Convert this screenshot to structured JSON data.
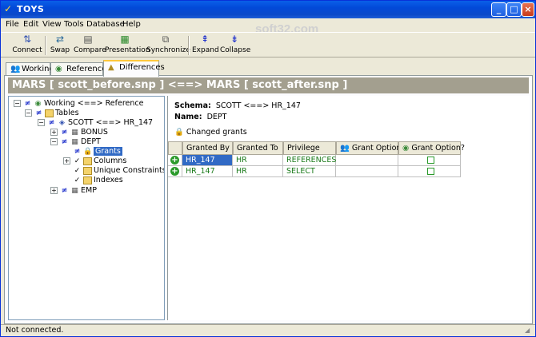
{
  "window": {
    "title": "TOYS",
    "app_icon": "check-icon",
    "watermark": "soft32.com",
    "controls": [
      "minimize",
      "maximize",
      "close"
    ]
  },
  "menu": {
    "items": [
      "File",
      "Edit",
      "View",
      "Tools",
      "Database",
      "Help"
    ]
  },
  "toolbar": {
    "connect": "Connect",
    "swap": "Swap",
    "compare": "Compare",
    "presentation": "Presentation",
    "synchronize": "Synchronize",
    "expand": "Expand",
    "collapse": "Collapse"
  },
  "tabs": [
    {
      "label": "Working",
      "icon": "people-icon",
      "active": false
    },
    {
      "label": "Reference",
      "icon": "database-icon",
      "active": false
    },
    {
      "label": "Differences",
      "icon": "differences-icon",
      "active": true
    }
  ],
  "banner": "MARS [ scott_before.snp ] <==> MARS [ scott_after.snp ]",
  "tree": {
    "root": "Working <==> Reference",
    "tables": "Tables",
    "schema": "SCOTT  <==>  HR_147",
    "bonus": "BONUS",
    "dept": "DEPT",
    "grants": "Grants",
    "columns": "Columns",
    "unique_constraints": "Unique Constraints",
    "indexes": "Indexes",
    "emp": "EMP"
  },
  "detail": {
    "schema_label": "Schema:",
    "schema_value": "SCOTT  <==>  HR_147",
    "name_label": "Name:",
    "name_value": "DEPT",
    "changed_label": "Changed grants"
  },
  "grid": {
    "headers": [
      "Granted By",
      "Granted To",
      "Privilege",
      "Grant Option?",
      "Grant Option?"
    ],
    "rows": [
      {
        "granted_by": "HR_147",
        "granted_to": "HR",
        "privilege": "REFERENCES",
        "grant_option_working": "",
        "grant_option_reference": false
      },
      {
        "granted_by": "HR_147",
        "granted_to": "HR",
        "privilege": "SELECT",
        "grant_option_working": "",
        "grant_option_reference": false
      }
    ]
  },
  "status": {
    "text": "Not connected."
  },
  "colors": {
    "titlebar": "#0249d8",
    "banner": "#a39f8f",
    "selection": "#316ac5",
    "added": "#1a7a1a"
  }
}
